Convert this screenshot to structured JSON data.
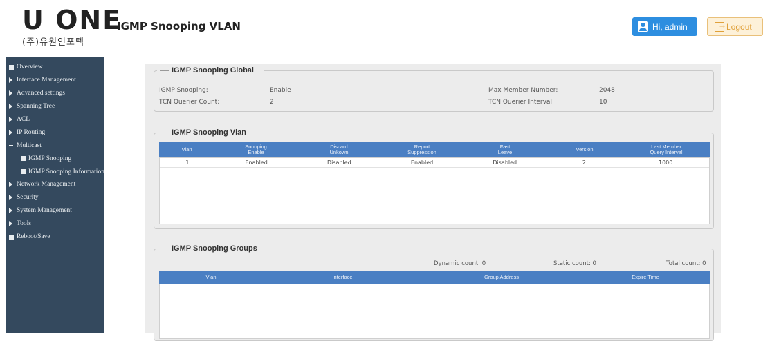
{
  "header": {
    "logo_main": "U ONE",
    "logo_sub": "(주)유원인포텍",
    "page_title": "IGMP Snooping VLAN",
    "user_button": "Hi, admin",
    "logout_button": "Logout",
    "colors": {
      "user_button": "#2d8ee0",
      "logout_button": "#fdf1d9",
      "sidebar": "#34495e",
      "table_header": "#4a7fc3"
    }
  },
  "sidebar": {
    "items": [
      {
        "label": "Overview",
        "marker": "square"
      },
      {
        "label": "Interface Management",
        "marker": "triangle"
      },
      {
        "label": "Advanced settings",
        "marker": "triangle"
      },
      {
        "label": "Spanning Tree",
        "marker": "triangle"
      },
      {
        "label": "ACL",
        "marker": "triangle"
      },
      {
        "label": "IP Routing",
        "marker": "triangle"
      },
      {
        "label": "Multicast",
        "marker": "dash"
      },
      {
        "label": "IGMP Snooping",
        "marker": "square",
        "sub": true
      },
      {
        "label": "IGMP Snooping Information",
        "marker": "square",
        "sub": true
      },
      {
        "label": "Network Management",
        "marker": "triangle"
      },
      {
        "label": "Security",
        "marker": "triangle"
      },
      {
        "label": "System Management",
        "marker": "triangle"
      },
      {
        "label": "Tools",
        "marker": "triangle"
      },
      {
        "label": "Reboot/Save",
        "marker": "square"
      }
    ]
  },
  "global": {
    "title": "IGMP Snooping Global",
    "snooping_label": "IGMP Snooping:",
    "snooping_value": "Enable",
    "tcn_count_label": "TCN Querier Count:",
    "tcn_count_value": "2",
    "max_member_label": "Max Member Number:",
    "max_member_value": "2048",
    "tcn_interval_label": "TCN Querier Interval:",
    "tcn_interval_value": "10"
  },
  "vlan": {
    "title": "IGMP Snooping Vlan",
    "columns": [
      [
        "Vlan",
        ""
      ],
      [
        "Snooping",
        "Enable"
      ],
      [
        "Discard",
        "Unkown"
      ],
      [
        "Report",
        "Suppression"
      ],
      [
        "Fast",
        "Leave"
      ],
      [
        "Version",
        ""
      ],
      [
        "Last Member",
        "Query Interval"
      ]
    ],
    "rows": [
      [
        "1",
        "Enabled",
        "Disabled",
        "Enabled",
        "Disabled",
        "2",
        "1000"
      ]
    ]
  },
  "groups": {
    "title": "IGMP Snooping Groups",
    "dynamic_count": "Dynamic count: 0",
    "static_count": "Static count: 0",
    "total_count": "Total count: 0",
    "columns": [
      "Vlan",
      "Interface",
      "Group Address",
      "Expire Time"
    ]
  }
}
